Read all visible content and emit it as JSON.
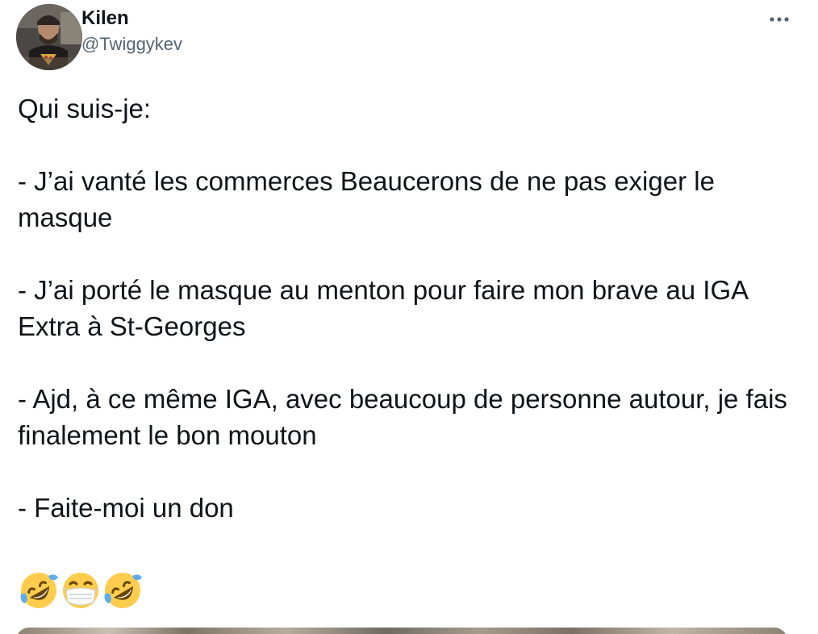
{
  "author": {
    "display_name": "Kilen",
    "handle": "@Twiggykev",
    "avatar_icon": "profile-photo-icon"
  },
  "menu": {
    "icon": "more-dots-icon"
  },
  "tweet": {
    "text": "Qui suis-je:\n\n- J’ai vanté les commerces Beaucerons de ne pas exiger le masque\n\n- J’ai porté le masque au menton pour faire mon brave au IGA Extra à St-Georges\n\n- Ajd, à ce même IGA, avec beaucoup de personne autour, je fais finalement le bon mouton\n\n- Faite-moi un don",
    "emojis": [
      "rolling-on-floor-laughing-icon",
      "face-with-medical-mask-icon",
      "rolling-on-floor-laughing-icon"
    ]
  },
  "colors": {
    "text": "#0f1419",
    "secondary": "#536471",
    "emoji_yellow": "#ffcc4d"
  }
}
